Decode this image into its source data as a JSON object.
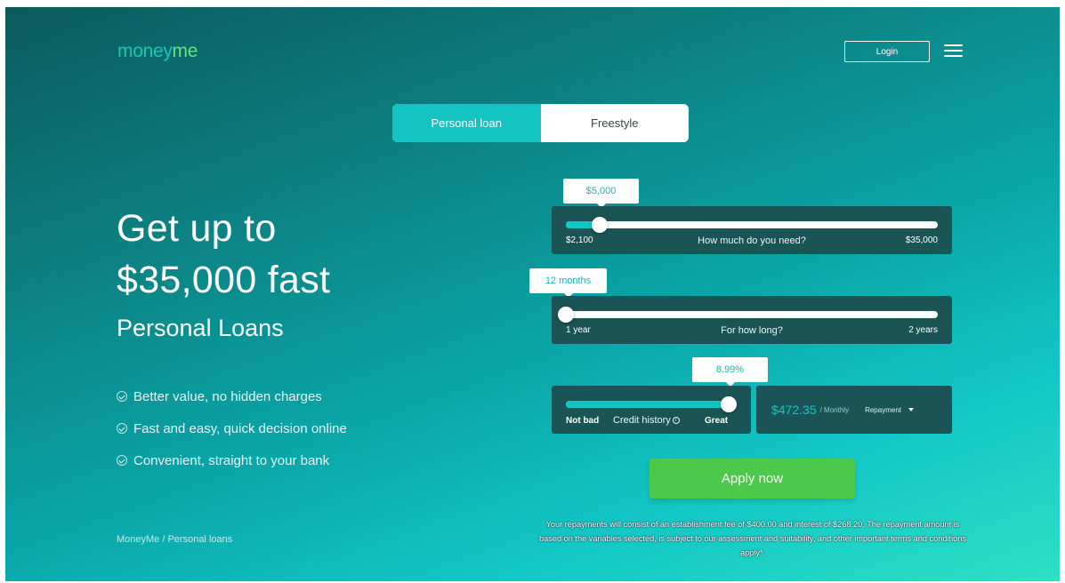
{
  "header": {
    "logo_part1": "money",
    "logo_part2": "me",
    "login_label": "Login",
    "menu_icon": "hamburger-menu-icon"
  },
  "loan_type": {
    "tabs": [
      {
        "label": "Personal loan",
        "active": true
      },
      {
        "label": "Freestyle",
        "active": false
      }
    ]
  },
  "hero": {
    "title_line1": "Get up to",
    "title_line2": "$35,000 fast",
    "subtitle": "Personal Loans",
    "bullets": [
      "Better value, no hidden charges",
      "Fast and easy, quick decision online",
      "Convenient, straight to your bank"
    ],
    "bullet_icon": "check-circle-icon"
  },
  "breadcrumb": "MoneyMe / Personal loans",
  "calculator": {
    "amount": {
      "value_label": "$5,000",
      "min_label": "$2,100",
      "max_label": "$35,000",
      "caption": "How much do you need?",
      "position_fraction": 0.09
    },
    "term": {
      "value_label": "12 months",
      "min_label": "1 year",
      "max_label": "2 years",
      "caption": "For how long?",
      "position_fraction": 0.0
    },
    "credit": {
      "value_label": "8.99%",
      "min_label": "Not bad",
      "max_label": "Great",
      "caption": "Credit history",
      "info_icon": "info-icon",
      "position_fraction": 1.0
    },
    "repayment": {
      "amount": "$472.35",
      "period": "/ Monthly",
      "selector_label": "Repayment",
      "selector_icon": "caret-down-icon"
    },
    "apply_label": "Apply now",
    "disclaimer": "Your repayments will consist of an establishment fee of $400.00 and interest of $268.20. The repayment amount is based on the variables selected, is subject to our assessment and suitability, and other important terms and conditions apply*."
  },
  "colors": {
    "accent": "#14c4c2",
    "button_green": "#4cc84a",
    "panel": "#1b5455",
    "logo_green": "#63e47a"
  }
}
